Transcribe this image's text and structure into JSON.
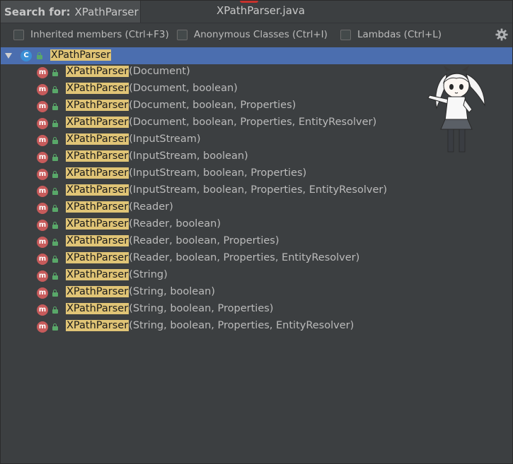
{
  "search": {
    "label": "Search for:",
    "value": "XPathParser"
  },
  "file_title": "XPathParser.java",
  "options": [
    {
      "label": "Inherited members (Ctrl+F3)",
      "checked": false
    },
    {
      "label": "Anonymous Classes (Ctrl+I)",
      "checked": false
    },
    {
      "label": "Lambdas (Ctrl+L)",
      "checked": false
    }
  ],
  "settings_icon": "gear-icon",
  "tree": {
    "root": {
      "name": "XPathParser",
      "icon": "class-icon",
      "selected": true
    },
    "methods": [
      {
        "name": "XPathParser",
        "params": "(Document)"
      },
      {
        "name": "XPathParser",
        "params": "(Document, boolean)"
      },
      {
        "name": "XPathParser",
        "params": "(Document, boolean, Properties)"
      },
      {
        "name": "XPathParser",
        "params": "(Document, boolean, Properties, EntityResolver)"
      },
      {
        "name": "XPathParser",
        "params": "(InputStream)"
      },
      {
        "name": "XPathParser",
        "params": "(InputStream, boolean)"
      },
      {
        "name": "XPathParser",
        "params": "(InputStream, boolean, Properties)"
      },
      {
        "name": "XPathParser",
        "params": "(InputStream, boolean, Properties, EntityResolver)"
      },
      {
        "name": "XPathParser",
        "params": "(Reader)"
      },
      {
        "name": "XPathParser",
        "params": "(Reader, boolean)"
      },
      {
        "name": "XPathParser",
        "params": "(Reader, boolean, Properties)"
      },
      {
        "name": "XPathParser",
        "params": "(Reader, boolean, Properties, EntityResolver)"
      },
      {
        "name": "XPathParser",
        "params": "(String)"
      },
      {
        "name": "XPathParser",
        "params": "(String, boolean)"
      },
      {
        "name": "XPathParser",
        "params": "(String, boolean, Properties)"
      },
      {
        "name": "XPathParser",
        "params": "(String, boolean, Properties, EntityResolver)"
      }
    ]
  },
  "colors": {
    "background": "#3c3f41",
    "selection": "#4b6eaf",
    "match_highlight": "#e0c476",
    "method_icon": "#c75b5b",
    "class_icon": "#3a8fd6",
    "public_lock": "#59a869"
  }
}
